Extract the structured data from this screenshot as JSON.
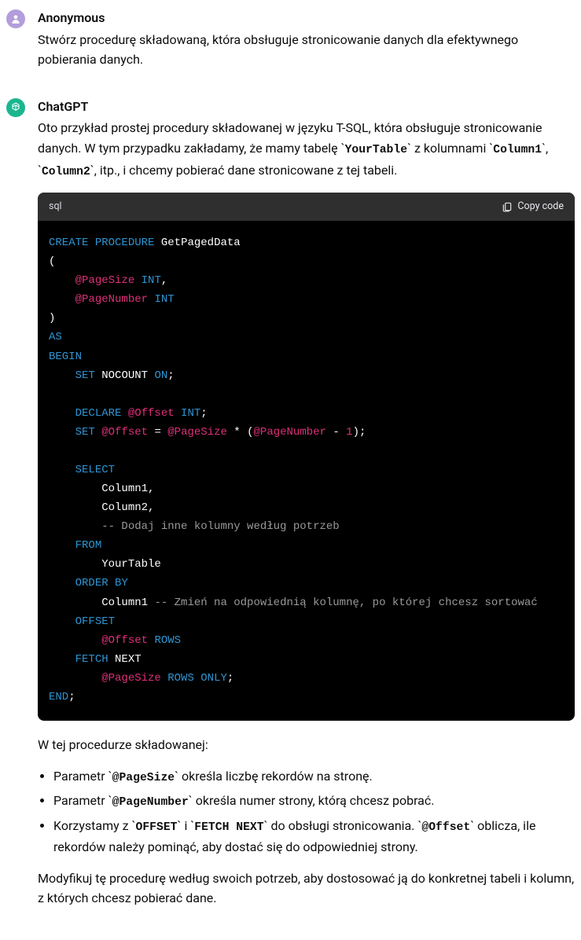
{
  "user": {
    "author": "Anonymous",
    "prompt": "Stwórz procedurę składowaną, która obsługuje stronicowanie danych dla efektywnego pobierania danych."
  },
  "assistant": {
    "author": "ChatGPT",
    "intro_pre": "Oto przykład prostej procedury składowanej w języku T-SQL, która obsługuje stronicowanie danych. W tym przypadku zakładamy, że mamy tabelę ",
    "intro_tbl": "YourTable",
    "intro_mid1": " z kolumnami ",
    "intro_col1": "Column1",
    "intro_comma": ", ",
    "intro_col2": "Column2",
    "intro_suffix": ", itp., i chcemy pobierać dane stronicowane z tej tabeli.",
    "code_lang": "sql",
    "copy_label": "Copy code",
    "code": {
      "t1": "CREATE",
      "t2": "PROCEDURE",
      "t3": "GetPagedData",
      "lp": "(",
      "p1": "@PageSize",
      "ty": "INT",
      "comma": ",",
      "p2": "@PageNumber",
      "rp": ")",
      "as": "AS",
      "begin": "BEGIN",
      "set": "SET",
      "nocount": "NOCOUNT",
      "on": "ON",
      "semi": ";",
      "declare": "DECLARE",
      "offset_var": "@Offset",
      "eq": "=",
      "star": "*",
      "lpar": "(",
      "minus": "-",
      "one": "1",
      "rpar": ")",
      "select": "SELECT",
      "col1": "Column1",
      "col2": "Column2",
      "c_cols": "-- Dodaj inne kolumny według potrzeb",
      "from": "FROM",
      "tbl": "YourTable",
      "orderby": "ORDER BY",
      "c_order": "-- Zmień na odpowiednią kolumnę, po której chcesz sortować",
      "offset": "OFFSET",
      "rows": "ROWS",
      "fetch": "FETCH",
      "next": "NEXT",
      "only": "ONLY",
      "end": "END"
    },
    "after_code": "W tej procedurze składowanej:",
    "bullet1_pre": "Parametr ",
    "bullet1_code": "@PageSize",
    "bullet1_post": " określa liczbę rekordów na stronę.",
    "bullet2_pre": "Parametr ",
    "bullet2_code": "@PageNumber",
    "bullet2_post": " określa numer strony, którą chcesz pobrać.",
    "bullet3_pre": "Korzystamy z ",
    "bullet3_code1": "OFFSET",
    "bullet3_mid1": " i ",
    "bullet3_code2": "FETCH NEXT",
    "bullet3_mid2": " do obsługi stronicowania. ",
    "bullet3_code3": "@Offset",
    "bullet3_post": " oblicza, ile rekordów należy pominąć, aby dostać się do odpowiedniej strony.",
    "closing": "Modyfikuj tę procedurę według swoich potrzeb, aby dostosować ją do konkretnej tabeli i kolumn, z których chcesz pobierać dane."
  }
}
